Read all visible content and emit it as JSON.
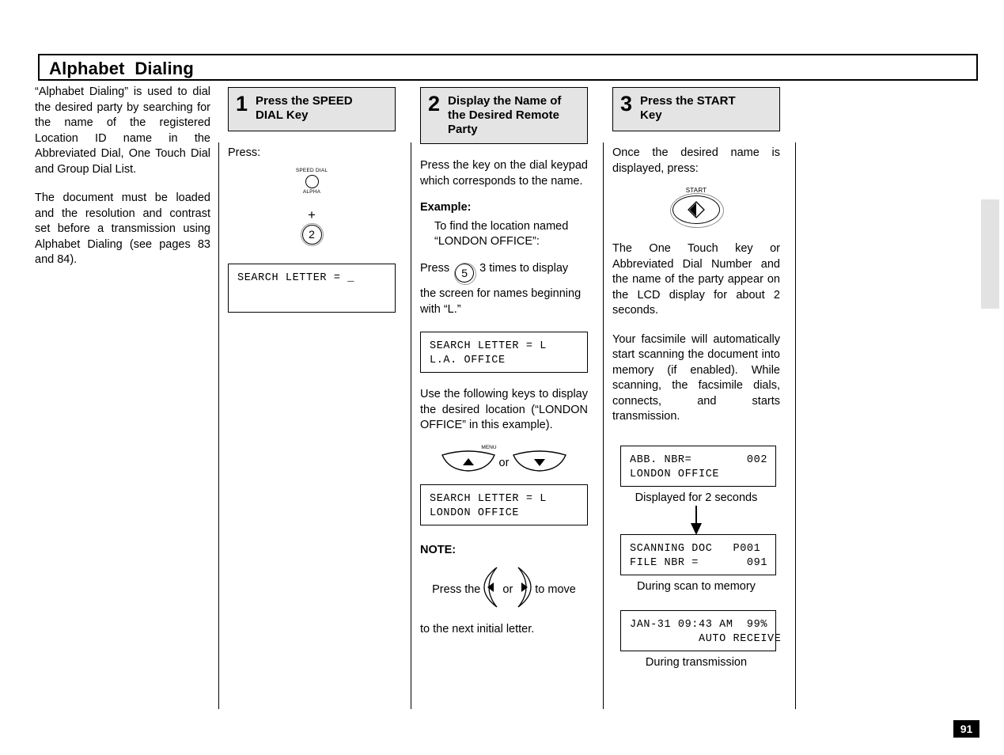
{
  "page": {
    "title": "Alphabet  Dialing",
    "page_number": "91"
  },
  "intro": {
    "paragraph_1": "“Alphabet Dialing” is used to dial the desired party by searching for the name of the registered Location ID name in the Abbreviated Dial, One Touch Dial and Group Dial List.",
    "paragraph_2": "The document must be loaded and the resolution and contrast set before a transmission using Alphabet Dialing (see pages 83 and 84)."
  },
  "steps": [
    {
      "number": "1",
      "title": "Press the SPEED\nDIAL Key",
      "press_label": "Press:",
      "speed_key": {
        "label_top": "SPEED DIAL",
        "label_bottom": "ALPHA"
      },
      "plus": "+",
      "digit_key": "2",
      "lcd_1": "SEARCH LETTER = _"
    },
    {
      "number": "2",
      "title": "Display the Name of\nthe Desired Remote\nParty",
      "intro_text": "Press the key on the dial keypad which corresponds to the name.",
      "example_heading": "Example:",
      "example_text": "To find the location named “LONDON OFFICE”:",
      "press_word": "Press",
      "press_digit": "5",
      "press_after": "3 times to display",
      "press_cont": "the screen for names beginning with “L.”",
      "lcd_1": "SEARCH LETTER = L\nL.A. OFFICE",
      "use_keys_text": "Use the following keys to display the desired location (“LONDON OFFICE” in this example).",
      "menu_label": "MENU",
      "or_label": "or",
      "lcd_2": "SEARCH LETTER = L\nLONDON OFFICE",
      "note_heading": "NOTE:",
      "note_before": "Press the",
      "note_or": "or",
      "note_after": "to move",
      "note_line2": "to the next initial letter."
    },
    {
      "number": "3",
      "title": "Press the START\nKey",
      "intro_text": "Once the desired name is displayed,  press:",
      "start_key_label": "START",
      "paragraph_1": "The One Touch key or Abbreviated Dial Number and the name of the party appear on the LCD display for about 2 seconds.",
      "paragraph_2": "Your facsimile will automatically start scanning the document into memory (if enabled). While scanning, the facsimile dials, connects, and starts transmission.",
      "lcd_1": "ABB. NBR=        002\nLONDON OFFICE",
      "caption_1": "Displayed for 2 seconds",
      "lcd_2": "SCANNING DOC   P001\nFILE NBR =       091",
      "caption_2": "During scan to memory",
      "lcd_3": "JAN-31 09:43 AM  99%\n          AUTO RECEIVE",
      "caption_3": "During  transmission"
    }
  ]
}
